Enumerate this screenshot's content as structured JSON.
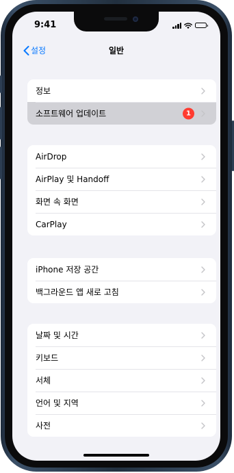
{
  "status_bar": {
    "time": "9:41"
  },
  "nav": {
    "back_label": "설정",
    "title": "일반"
  },
  "groups": [
    {
      "rows": [
        {
          "label": "정보"
        },
        {
          "label": "소프트웨어 업데이트",
          "badge": "1",
          "highlighted": true
        }
      ]
    },
    {
      "rows": [
        {
          "label": "AirDrop"
        },
        {
          "label": "AirPlay 및 Handoff"
        },
        {
          "label": "화면 속 화면"
        },
        {
          "label": "CarPlay"
        }
      ]
    },
    {
      "rows": [
        {
          "label": "iPhone 저장 공간"
        },
        {
          "label": "백그라운드 앱 새로 고침"
        }
      ]
    },
    {
      "rows": [
        {
          "label": "날짜 및 시간"
        },
        {
          "label": "키보드"
        },
        {
          "label": "서체"
        },
        {
          "label": "언어 및 지역"
        },
        {
          "label": "사전"
        }
      ]
    }
  ],
  "colors": {
    "accent": "#0a7aff",
    "badge": "#ff3b30",
    "background": "#f2f2f7",
    "highlight": "#d1d1d6"
  },
  "icons": {
    "back": "chevron-left-icon",
    "disclosure": "chevron-right-icon"
  }
}
